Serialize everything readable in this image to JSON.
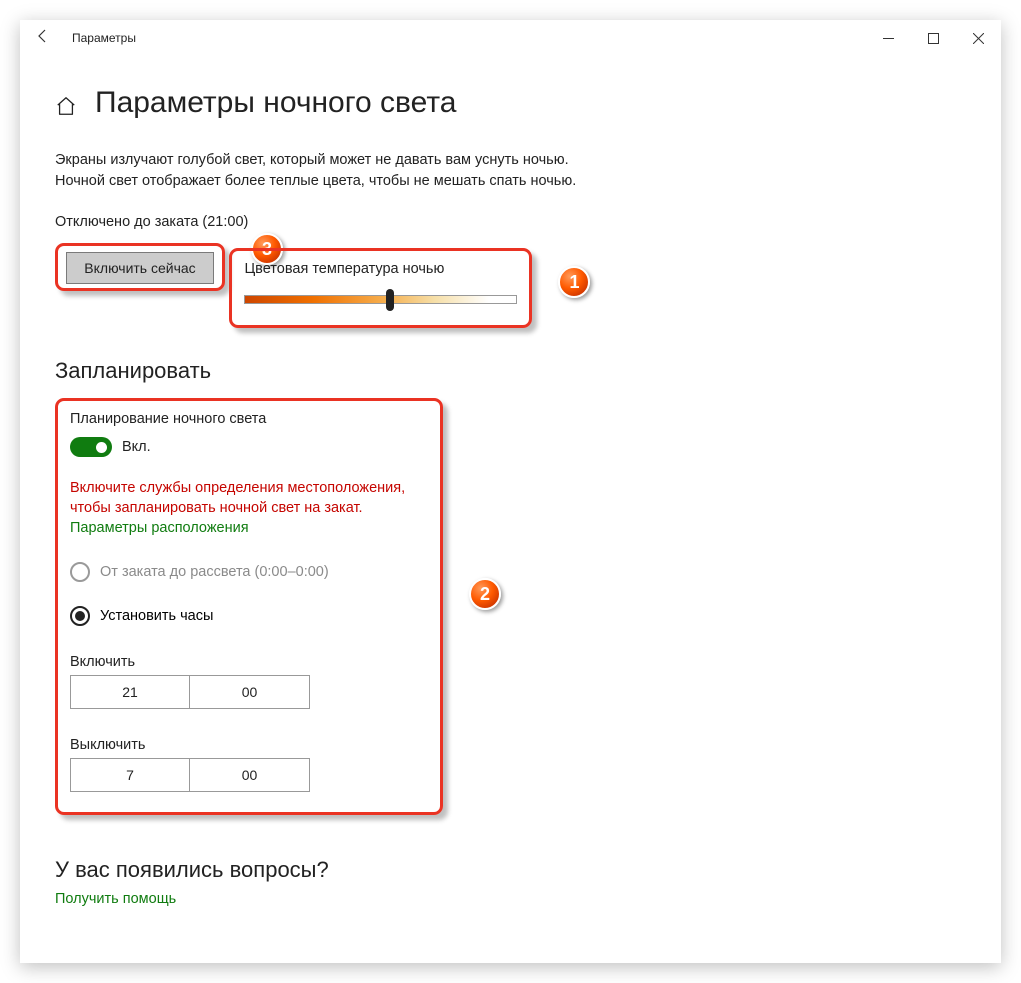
{
  "titlebar": {
    "title": "Параметры"
  },
  "page": {
    "title": "Параметры ночного света",
    "description": "Экраны излучают голубой свет, который может не давать вам уснуть ночью. Ночной свет отображает более теплые цвета, чтобы не мешать спать ночью.",
    "status": "Отключено до заката (21:00)",
    "enable_button": "Включить сейчас"
  },
  "temp": {
    "label": "Цветовая температура ночью"
  },
  "schedule": {
    "heading": "Запланировать",
    "plan_label": "Планирование ночного света",
    "toggle_state": "Вкл.",
    "warning": "Включите службы определения местоположения, чтобы запланировать ночной свет на закат.",
    "location_link": "Параметры расположения",
    "radio_sunset": "От заката до рассвета (0:00–0:00)",
    "radio_hours": "Установить часы",
    "turn_on_label": "Включить",
    "on_hour": "21",
    "on_min": "00",
    "turn_off_label": "Выключить",
    "off_hour": "7",
    "off_min": "00"
  },
  "faq": {
    "heading": "У вас появились вопросы?",
    "link": "Получить помощь"
  },
  "badges": {
    "b1": "1",
    "b2": "2",
    "b3": "3"
  }
}
